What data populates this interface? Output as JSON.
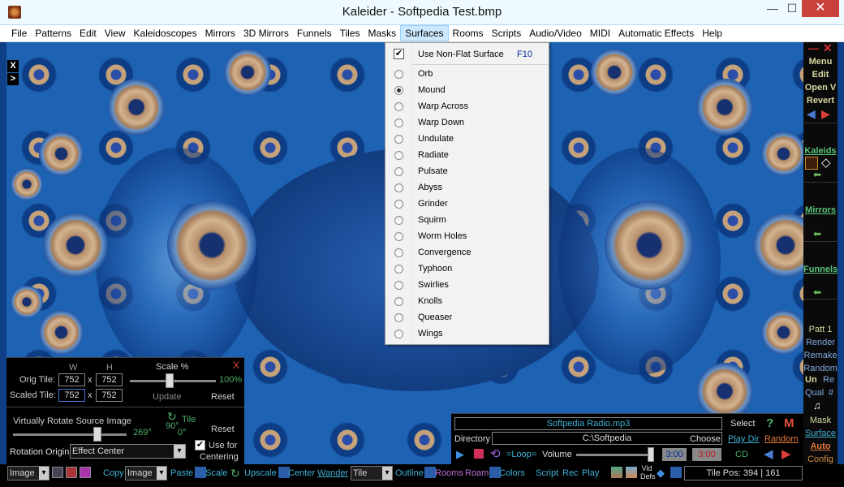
{
  "window": {
    "title": "Kaleider - Softpedia Test.bmp",
    "minimize": "—",
    "maximize": "☐",
    "close": "✕"
  },
  "menubar": [
    "File",
    "Patterns",
    "Edit",
    "View",
    "Kaleidoscopes",
    "Mirrors",
    "3D Mirrors",
    "Funnels",
    "Tiles",
    "Masks",
    "Surfaces",
    "Rooms",
    "Scripts",
    "Audio/Video",
    "MIDI",
    "Automatic Effects",
    "Help"
  ],
  "left_buttons": {
    "x": "X",
    "more": ">"
  },
  "dropdown": {
    "nonflat": {
      "label": "Use Non-Flat Surface",
      "shortcut": "F10",
      "checked": true
    },
    "items": [
      "Orb",
      "Mound",
      "Warp Across",
      "Warp Down",
      "Undulate",
      "Radiate",
      "Pulsate",
      "Abyss",
      "Grinder",
      "Squirm",
      "Worm Holes",
      "Convergence",
      "Typhoon",
      "Swirlies",
      "Knolls",
      "Queaser",
      "Wings"
    ],
    "selected": "Mound"
  },
  "right_panel": {
    "menu": "Menu",
    "edit": "Edit",
    "open": "Open V",
    "revert": "Revert",
    "kaleids": "Kaleids",
    "mirrors": "Mirrors",
    "funnels": "Funnels",
    "patt": "Patt 1",
    "render": "Render",
    "remake": "Remake",
    "random": "Random",
    "un": "Un",
    "re": "Re",
    "qual": "Qual",
    "hash": "#",
    "mask": "Mask",
    "surface": "Surface",
    "auto": "Auto",
    "config": "Config"
  },
  "tile_panel": {
    "close": "X",
    "w_label": "W",
    "h_label": "H",
    "scale_label": "Scale %",
    "orig_label": "Orig Tile:",
    "orig_w": "752",
    "orig_h": "752",
    "scaled_label": "Scaled Tile:",
    "scaled_w": "752",
    "scaled_h": "752",
    "scale_value": "100%",
    "update": "Update",
    "reset": "Reset",
    "times": "x",
    "rotate_label": "Virtually Rotate Source Image",
    "rotate_value": "269°",
    "ninety": "90°",
    "tile": "Tile",
    "zero": "0°",
    "reset2": "Reset",
    "origin_label": "Rotation Origin",
    "origin_value": "Effect Center",
    "use_for": "Use for",
    "centering": "Centering"
  },
  "radio_panel": {
    "track": "Softpedia Radio.mp3",
    "select": "Select",
    "directory_label": "Directory",
    "directory": "C:\\Softpedia",
    "choose": "Choose",
    "play_dir": "Play Dir",
    "random": "Random",
    "loop": "=Loop=",
    "volume": "Volume",
    "time1": "3:00",
    "time2": "3:00",
    "cd": "CD",
    "help": "?",
    "m": "M"
  },
  "bottom_bar": {
    "image": "Image",
    "copy": "Copy",
    "image2": "Image",
    "paste": "Paste",
    "scale": "Scale",
    "upscale": "Upscale",
    "center": "Center",
    "wander": "Wander",
    "tile": "Tile",
    "outline": "Outline",
    "rooms": "Rooms",
    "roam": "Roam",
    "colors": "Colors",
    "script": "Script",
    "rec": "Rec",
    "play": "Play",
    "vid": "Vid",
    "defs": "Defs",
    "tile_pos": "Tile Pos:  394 | 161"
  },
  "colors": {
    "accent_cyan": "#3fb0d6",
    "panel_black": "#000000",
    "menu_highlight": "#cce8ff"
  }
}
